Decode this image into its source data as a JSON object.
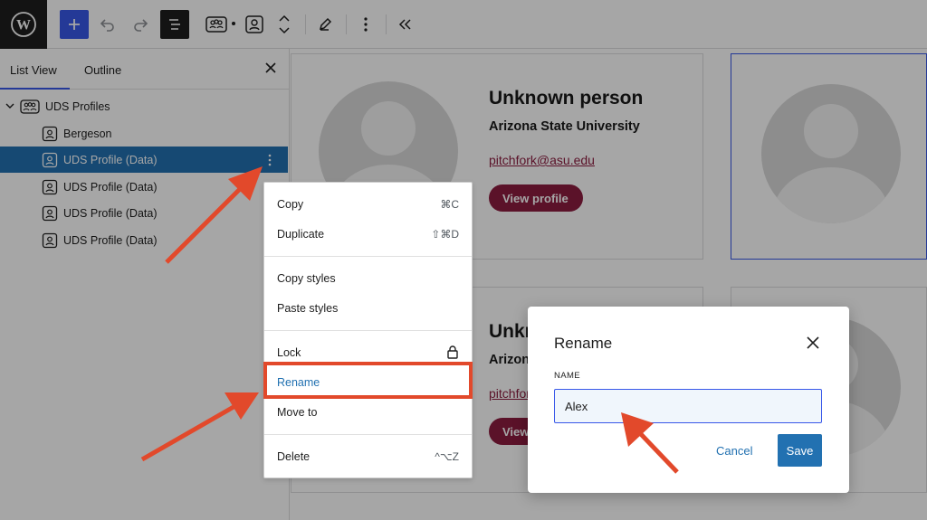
{
  "toolbar": {
    "logo_icon": "wordpress-logo-icon",
    "add_icon": "plus-icon",
    "undo_icon": "undo-icon",
    "redo_icon": "redo-icon",
    "list_view_icon": "list-view-icon",
    "block_group_icon": "group-icon",
    "block_profile_icon": "profile-icon",
    "move_icon": "chevron-up-down-icon",
    "edit_icon": "pencil-icon",
    "options_icon": "more-vertical-icon",
    "collapse_icon": "double-chevron-left-icon"
  },
  "sidebar": {
    "tabs": [
      {
        "label": "List View",
        "active": true
      },
      {
        "label": "Outline",
        "active": false
      }
    ],
    "close_icon": "close-icon",
    "tree": [
      {
        "label": "UDS Profiles",
        "level": 0,
        "icon": "group-icon",
        "expanded": true
      },
      {
        "label": "Bergeson",
        "level": 1,
        "icon": "profile-icon"
      },
      {
        "label": "UDS Profile (Data)",
        "level": 1,
        "icon": "profile-icon",
        "selected": true
      },
      {
        "label": "UDS Profile (Data)",
        "level": 1,
        "icon": "profile-icon"
      },
      {
        "label": "UDS Profile (Data)",
        "level": 1,
        "icon": "profile-icon"
      },
      {
        "label": "UDS Profile (Data)",
        "level": 1,
        "icon": "profile-icon"
      }
    ]
  },
  "canvas": {
    "cards": [
      {
        "name": "Unknown person",
        "org": "Arizona State University",
        "email": "pitchfork@asu.edu",
        "button": "View profile"
      },
      {
        "name": "Unkn",
        "org": "Arizon",
        "email": "pitchfor",
        "button": "View"
      }
    ]
  },
  "context_menu": {
    "items": [
      {
        "label": "Copy",
        "shortcut": "⌘C"
      },
      {
        "label": "Duplicate",
        "shortcut": "⇧⌘D"
      },
      {
        "label": "Copy styles",
        "shortcut": ""
      },
      {
        "label": "Paste styles",
        "shortcut": ""
      },
      {
        "label": "Lock",
        "shortcut": "",
        "icon": "lock-icon"
      },
      {
        "label": "Rename",
        "shortcut": ""
      },
      {
        "label": "Move to",
        "shortcut": ""
      },
      {
        "label": "Delete",
        "shortcut": "^⌥Z"
      }
    ]
  },
  "rename_modal": {
    "title": "Rename",
    "label": "NAME",
    "value": "Alex",
    "cancel": "Cancel",
    "save": "Save"
  },
  "colors": {
    "accent": "#3858e9",
    "selected_row": "#2271b1",
    "asu_maroon": "#8c1d40",
    "annotation_red": "#e2492b"
  }
}
